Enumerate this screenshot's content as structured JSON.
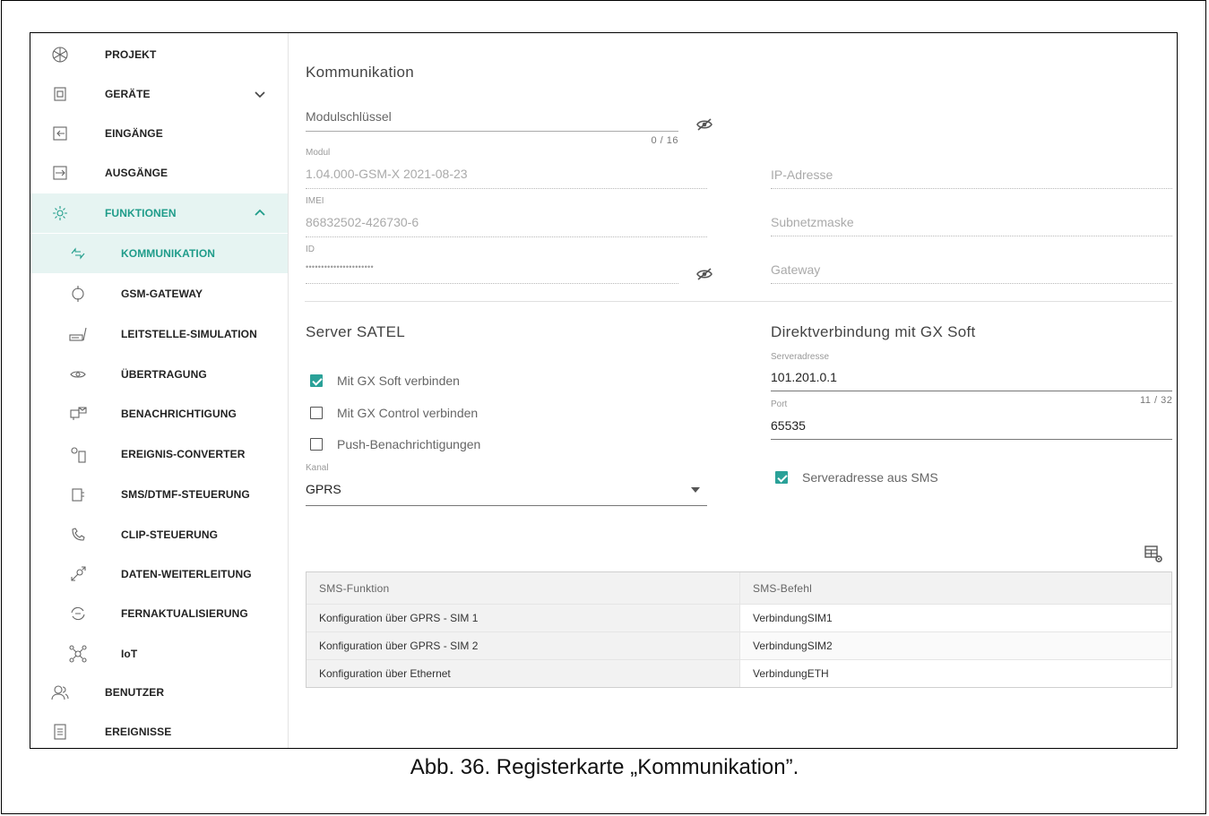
{
  "sidebar": {
    "items": [
      {
        "label": "PROJEKT",
        "icon": "project-icon"
      },
      {
        "label": "GERÄTE",
        "icon": "devices-icon"
      },
      {
        "label": "EINGÄNGE",
        "icon": "inputs-icon"
      },
      {
        "label": "AUSGÄNGE",
        "icon": "outputs-icon"
      },
      {
        "label": "FUNKTIONEN",
        "icon": "gear-icon"
      },
      {
        "label": "KOMMUNIKATION",
        "icon": "communication-icon"
      },
      {
        "label": "GSM-GATEWAY",
        "icon": "gsm-gateway-icon"
      },
      {
        "label": "LEITSTELLE-SIMULATION",
        "icon": "monitoring-station-icon"
      },
      {
        "label": "ÜBERTRAGUNG",
        "icon": "eye-icon"
      },
      {
        "label": "BENACHRICHTIGUNG",
        "icon": "notification-icon"
      },
      {
        "label": "EREIGNIS-CONVERTER",
        "icon": "event-converter-icon"
      },
      {
        "label": "SMS/DTMF-STEUERUNG",
        "icon": "sms-dtmf-icon"
      },
      {
        "label": "CLIP-STEUERUNG",
        "icon": "clip-phone-icon"
      },
      {
        "label": "DATEN-WEITERLEITUNG",
        "icon": "data-forwarding-icon"
      },
      {
        "label": "FERNAKTUALISIERUNG",
        "icon": "remote-update-icon"
      },
      {
        "label": "IoT",
        "icon": "iot-icon"
      },
      {
        "label": "BENUTZER",
        "icon": "users-icon"
      },
      {
        "label": "EREIGNISSE",
        "icon": "events-icon"
      }
    ]
  },
  "main": {
    "title": "Kommunikation",
    "module_key": {
      "placeholder": "Modulschlüssel",
      "counter": "0 / 16"
    },
    "module": {
      "label": "Modul",
      "value": "1.04.000-GSM-X 2021-08-23"
    },
    "imei": {
      "label": "IMEI",
      "value": "86832502-426730-6"
    },
    "id": {
      "label": "ID",
      "value": "••••••••••••••••••••••"
    },
    "ip_address": {
      "placeholder": "IP-Adresse"
    },
    "subnet_mask": {
      "placeholder": "Subnetzmaske"
    },
    "gateway": {
      "placeholder": "Gateway"
    },
    "server_satel": {
      "title": "Server SATEL",
      "checkboxes": [
        {
          "label": "Mit GX Soft verbinden",
          "checked": true
        },
        {
          "label": "Mit GX Control verbinden",
          "checked": false
        },
        {
          "label": "Push-Benachrichtigungen",
          "checked": false
        }
      ],
      "channel": {
        "label": "Kanal",
        "value": "GPRS"
      }
    },
    "direct": {
      "title": "Direktverbindung mit GX Soft",
      "server_address": {
        "label": "Serveradresse",
        "value": "101.201.0.1",
        "counter": "11 / 32"
      },
      "port": {
        "label": "Port",
        "value": "65535"
      },
      "sms_checkbox": {
        "label": "Serveradresse aus SMS",
        "checked": true
      }
    },
    "table": {
      "headers": [
        "SMS-Funktion",
        "SMS-Befehl"
      ],
      "rows": [
        [
          "Konfiguration über GPRS - SIM 1",
          "VerbindungSIM1"
        ],
        [
          "Konfiguration über GPRS - SIM 2",
          "VerbindungSIM2"
        ],
        [
          "Konfiguration über Ethernet",
          "VerbindungETH"
        ]
      ]
    }
  },
  "caption": "Abb. 36. Registerkarte „Kommunikation”.",
  "colors": {
    "accent": "#2aa198",
    "active_bg": "#e6f4f2",
    "active_text": "#1f9c8a"
  }
}
